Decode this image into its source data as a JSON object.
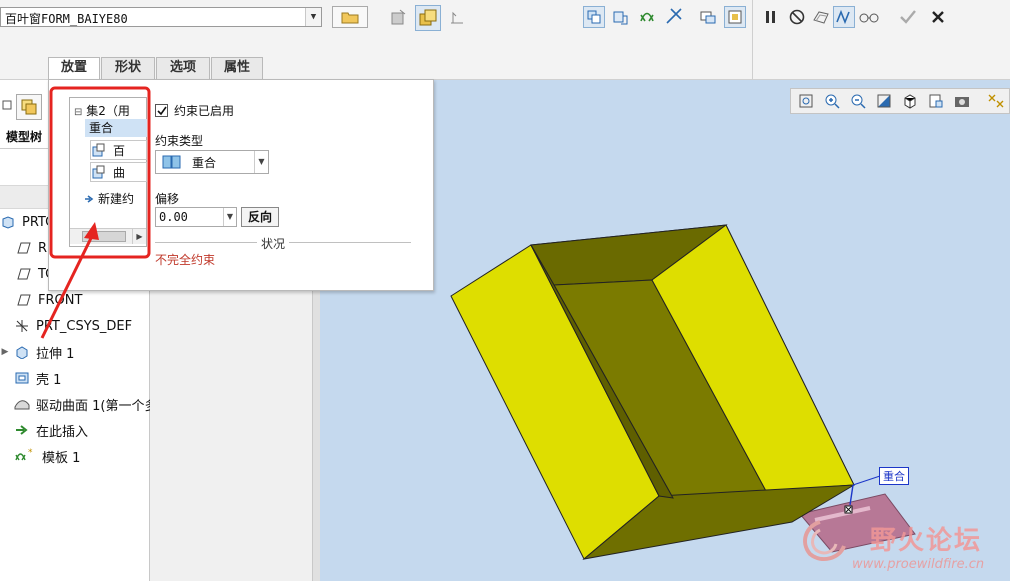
{
  "toolbar": {
    "combo_value": "百叶窗FORM_BAIYE80"
  },
  "tabs": [
    {
      "label": "放置"
    },
    {
      "label": "形状"
    },
    {
      "label": "选项"
    },
    {
      "label": "属性"
    }
  ],
  "panel": {
    "set_label": "集2（用",
    "selected_constraint": "重合",
    "ref1": "百",
    "ref2": "曲",
    "new_constraint": "新建约",
    "enabled_label": "约束已启用",
    "type_label": "约束类型",
    "type_value": "重合",
    "offset_label": "偏移",
    "offset_value": "0.00",
    "flip_button": "反向",
    "status_label": "状况",
    "status_value": "不完全约束"
  },
  "tree": {
    "header": "模型树",
    "items": [
      {
        "label": "PRTC"
      },
      {
        "label": "R"
      },
      {
        "label": "TC"
      },
      {
        "label": "FRONT"
      },
      {
        "label": "PRT_CSYS_DEF"
      },
      {
        "label": "拉伸 1"
      },
      {
        "label": "壳 1"
      },
      {
        "label": "驱动曲面 1(第一个多"
      },
      {
        "label": "在此插入"
      },
      {
        "label": "模板 1"
      }
    ]
  },
  "viewport": {
    "constraint_tag": "重合"
  },
  "watermark": {
    "title": "野火论坛",
    "url": "www.proewildfire.cn"
  },
  "colors": {
    "box_yellow": "#dede00",
    "box_dark": "#7b7b00",
    "annotation_red": "#e52420",
    "viewport_bg": "#c5d9ee",
    "status_red": "#c0392b"
  }
}
